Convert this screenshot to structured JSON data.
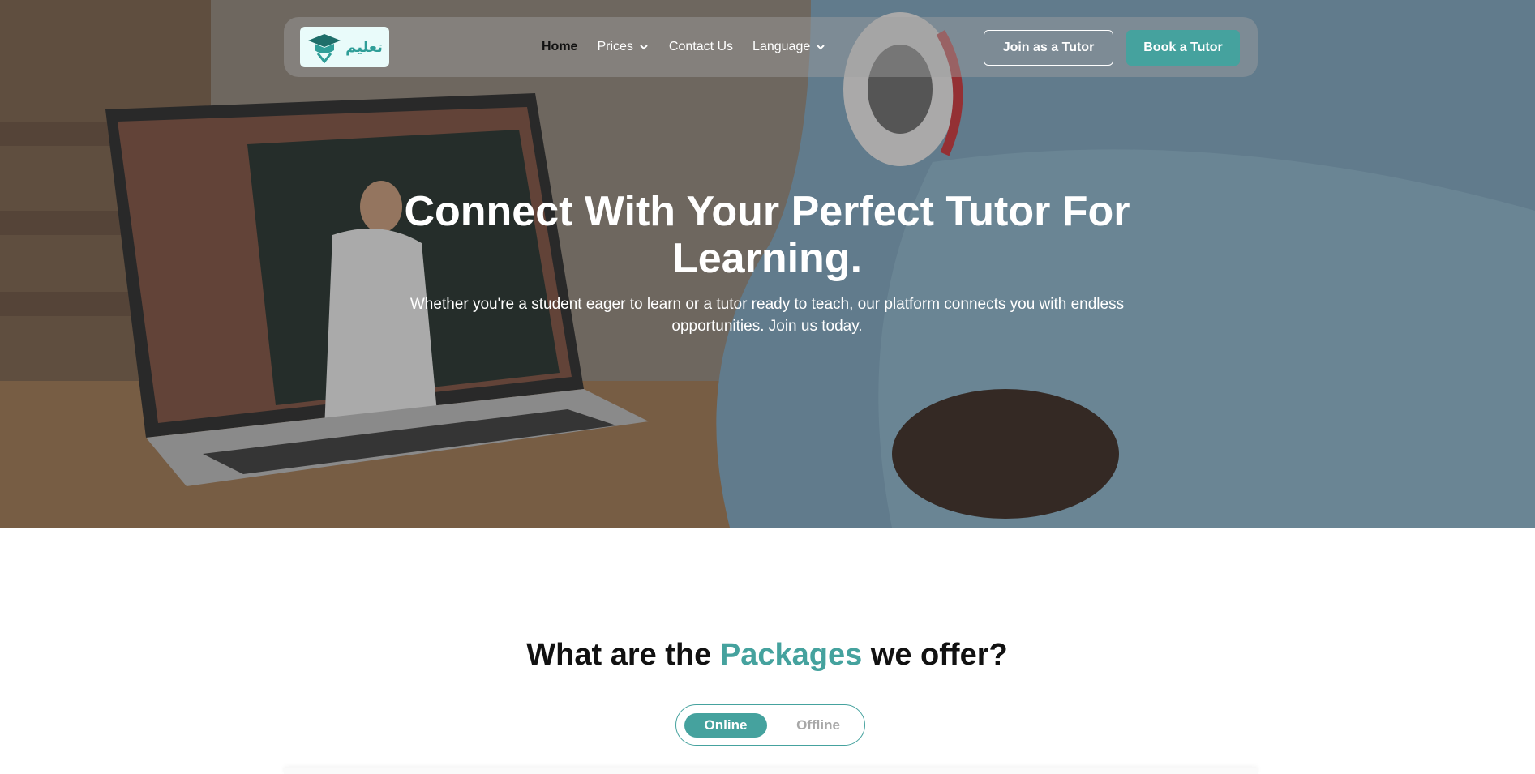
{
  "nav": {
    "logo_text": "تعليم",
    "links": [
      {
        "label": "Home"
      },
      {
        "label": "Prices"
      },
      {
        "label": "Contact Us"
      },
      {
        "label": "Language"
      }
    ],
    "join_tutor_label": "Join as a Tutor",
    "book_tutor_label": "Book a Tutor"
  },
  "hero": {
    "title_line1": "Connect With Your Perfect Tutor For",
    "title_line2": "Learning.",
    "subtitle_line1": "Whether you're a student eager to learn or a tutor ready to teach, our platform connects you with endless",
    "subtitle_line2": "opportunities. Join us today."
  },
  "packages": {
    "title_before": "What are the",
    "title_accent": "Packages",
    "title_after": "we offer?",
    "toggle": {
      "online_label": "Online",
      "offline_label": "Offline",
      "selected": "Online"
    }
  },
  "colors": {
    "accent": "#45a29e",
    "hero_overlay": "#282828",
    "logo_bg": "#e9fbfa",
    "toggle_inactive_text": "#a8a8a8"
  }
}
